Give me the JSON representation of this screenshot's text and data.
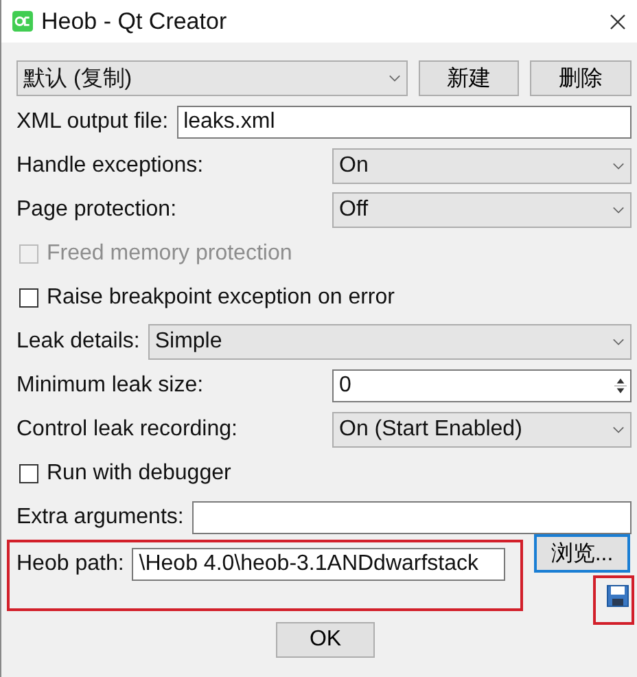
{
  "window": {
    "title": "Heob - Qt Creator"
  },
  "profile": {
    "value": "默认 (复制)",
    "buttons": [
      "新建",
      "删除"
    ]
  },
  "rows": [
    {
      "kind": "field",
      "label": "XML output file:",
      "value": "leaks.xml"
    },
    {
      "kind": "combo",
      "label": "Handle exceptions:",
      "value": "On"
    },
    {
      "kind": "combo",
      "label": "Page protection:",
      "value": "Off"
    },
    {
      "kind": "checkbox",
      "label": "Freed memory protection",
      "checked": false,
      "disabled": true
    },
    {
      "kind": "checkbox",
      "label": "Raise breakpoint exception on error",
      "checked": false,
      "disabled": false
    },
    {
      "kind": "combo-inline",
      "label": "Leak details:",
      "value": "Simple"
    },
    {
      "kind": "spin",
      "label": "Minimum leak size:",
      "value": "0"
    },
    {
      "kind": "combo",
      "label": "Control leak recording:",
      "value": "On (Start Enabled)"
    },
    {
      "kind": "checkbox",
      "label": "Run with debugger",
      "checked": false,
      "disabled": false
    },
    {
      "kind": "field",
      "label": "Extra arguments:",
      "value": ""
    }
  ],
  "heob_path": {
    "label": "Heob path:",
    "value": "\\Heob 4.0\\heob-3.1ANDdwarfstack",
    "browse": "浏览..."
  },
  "ok": "OK"
}
